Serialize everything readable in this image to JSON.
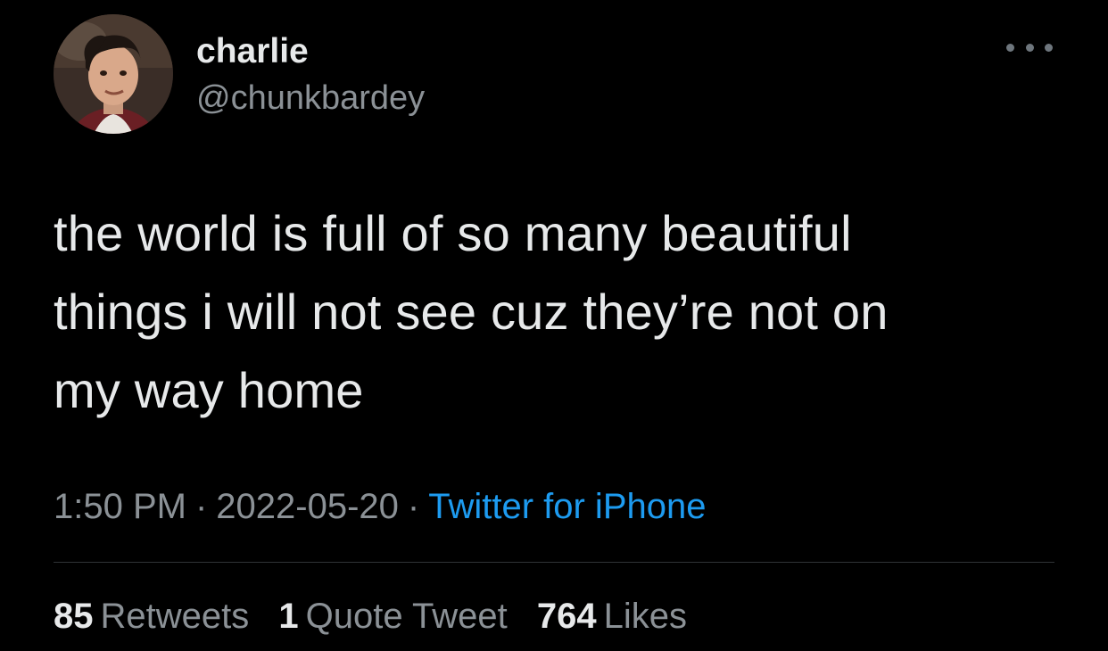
{
  "colors": {
    "background": "#000000",
    "primary_text": "#e7e9ea",
    "secondary_text": "#8b9196",
    "link": "#1d9bf0",
    "divider": "#2f3336"
  },
  "author": {
    "display_name": "charlie",
    "handle": "@chunkbardey",
    "avatar_icon": "profile-photo"
  },
  "more_icon": "more-horizontal-icon",
  "tweet": {
    "lines": [
      "the world is full of so many beautiful",
      "things i will not see cuz they’re not on",
      "my way home"
    ]
  },
  "meta": {
    "time": "1:50 PM",
    "separator": "·",
    "date": "2022-05-20",
    "source": "Twitter for iPhone"
  },
  "stats": {
    "retweets_count": "85",
    "retweets_label": "Retweets",
    "quotes_count": "1",
    "quotes_label": "Quote Tweet",
    "likes_count": "764",
    "likes_label": "Likes"
  }
}
